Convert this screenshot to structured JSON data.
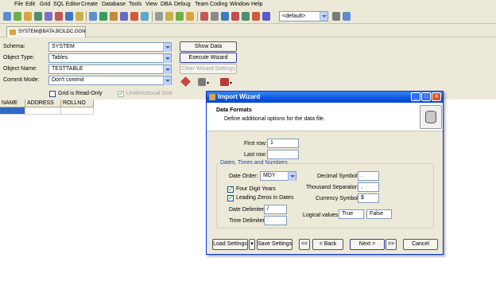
{
  "menu": [
    "File",
    "Edit",
    "Grid",
    "SQL Editor",
    "Create",
    "Database",
    "Tools",
    "View",
    "DBA",
    "Debug",
    "Team Coding",
    "Window",
    "Help"
  ],
  "toolbar": {
    "connection_select": "<default>"
  },
  "session_tab": "SYSTEM@BATA.BCILDC.GGN",
  "form": {
    "schema_label": "Schema:",
    "schema_value": "SYSTEM",
    "object_type_label": "Object Type:",
    "object_type_value": "Tables",
    "object_name_label": "Object Name:",
    "object_name_value": "TESTTABLE",
    "commit_mode_label": "Commit Mode:",
    "commit_mode_value": "Don't commit",
    "show_data_button": "Show Data",
    "execute_wizard_button": "Execute Wizard",
    "clear_wizard_settings_button": "Clear Wizard Settings",
    "grid_readonly_label": "Grid is Read-Only",
    "unidirectional_grid_label": "Unidirectional Grid"
  },
  "grid": {
    "columns": [
      "NAME",
      "ADDRESS",
      "ROLLNO"
    ]
  },
  "wizard": {
    "title": "Import Wizard",
    "section_title": "Data Formats",
    "section_subtitle": "Define additional options for the data file.",
    "first_row_label": "First row:",
    "first_row_value": "1",
    "last_row_label": "Last row:",
    "last_row_value": "",
    "group_title": "Dates, Times and Numbers",
    "date_order_label": "Date Order:",
    "date_order_value": "MDY",
    "four_digit_years_label": "Four Digit Years",
    "four_digit_years_checked": true,
    "leading_zeros_label": "Leading Zeros in Dates",
    "leading_zeros_checked": true,
    "date_delimiter_label": "Date Delimiter:",
    "date_delimiter_value": "/",
    "time_delimiter_label": "Time Delimiter:",
    "time_delimiter_value": ":",
    "decimal_symbol_label": "Decimal Symbol:",
    "decimal_symbol_value": ".",
    "thousand_separator_label": "Thousand Separator:",
    "thousand_separator_value": ",",
    "currency_symbol_label": "Currency Symbol:",
    "currency_symbol_value": "$",
    "logical_values_label": "Logical values:",
    "logical_true": "True",
    "logical_false": "False",
    "load_settings_button": "Load Settings",
    "save_settings_button": "Save Settings",
    "first_page_button": "<<",
    "back_button": "< Back",
    "next_button": "Next >",
    "last_page_button": ">>",
    "cancel_button": "Cancel"
  },
  "colors": {
    "xp_face": "#ece9d8",
    "title_blue": "#0b55e0",
    "selected_cell": "#316ac5"
  }
}
